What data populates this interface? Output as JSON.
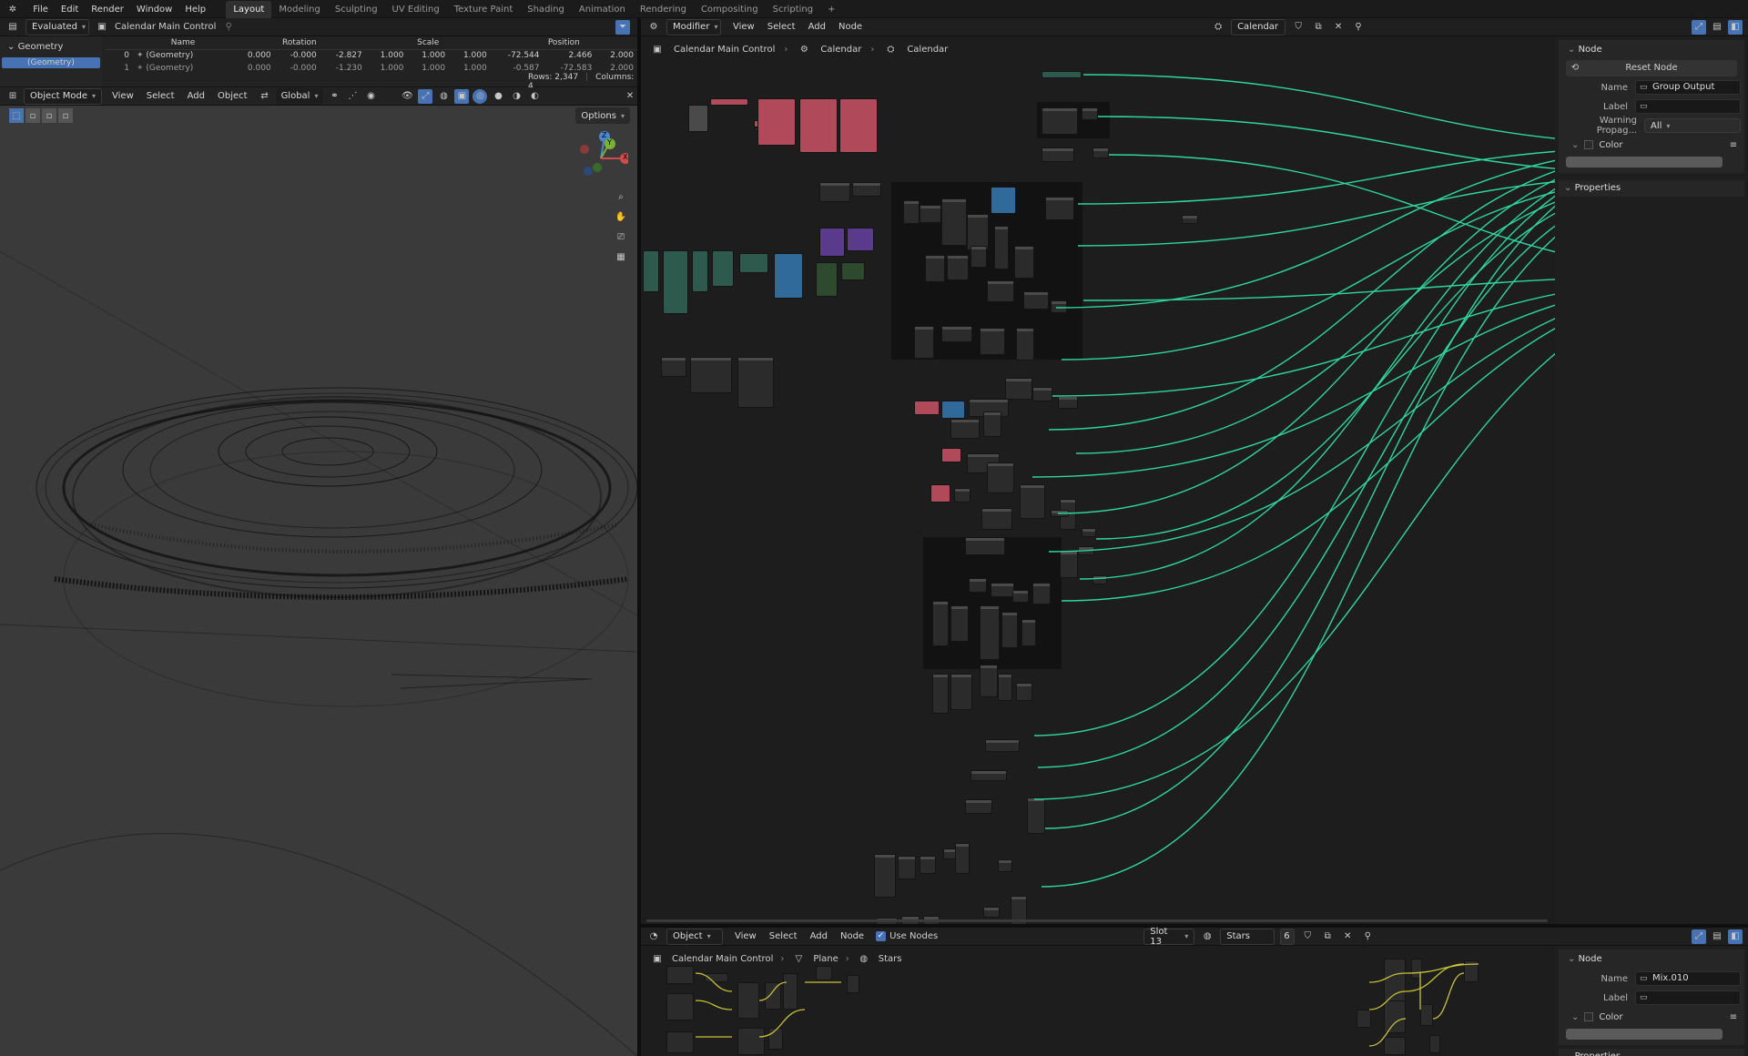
{
  "topbar": {
    "menus": [
      "File",
      "Edit",
      "Render",
      "Window",
      "Help"
    ],
    "workspaces": [
      "Layout",
      "Modeling",
      "Sculpting",
      "UV Editing",
      "Texture Paint",
      "Shading",
      "Animation",
      "Rendering",
      "Compositing",
      "Scripting"
    ],
    "active_workspace": "Layout",
    "add_tab": "+"
  },
  "spreadsheet": {
    "mode": "Evaluated",
    "object": "Calendar Main Control",
    "sidebar_item": "Geometry",
    "sidebar_subitem": "(Geometry)",
    "columns": [
      "Name",
      "Rotation",
      "Scale",
      "Position"
    ],
    "rows": [
      {
        "index": "0",
        "name": "(Geometry)",
        "rot": [
          "0.000",
          "-0.000",
          "-2.827"
        ],
        "scale": [
          "1.000",
          "1.000",
          "1.000"
        ],
        "pos": [
          "-72.544",
          "2.466",
          "2.000"
        ]
      },
      {
        "index": "1",
        "name": "(Geometry)",
        "rot": [
          "0.000",
          "-0.000",
          "-1.230"
        ],
        "scale": [
          "1.000",
          "1.000",
          "1.000"
        ],
        "pos": [
          "-0.587",
          "-72.583",
          "2.000"
        ]
      }
    ],
    "rows_label": "Rows: 2,347",
    "columns_label": "Columns: 4"
  },
  "viewport": {
    "mode": "Object Mode",
    "menus": [
      "View",
      "Select",
      "Add",
      "Object"
    ],
    "transform": "Global",
    "options": "Options",
    "gizmo": {
      "x": "X",
      "y": "Y",
      "z": "Z"
    }
  },
  "node_editor": {
    "type": "Modifier",
    "menus": [
      "View",
      "Select",
      "Add",
      "Node"
    ],
    "tree_name": "Calendar",
    "breadcrumb": [
      "Calendar Main Control",
      "Calendar",
      "Calendar"
    ]
  },
  "node_sidebar": {
    "section": "Node",
    "reset_button": "Reset Node",
    "name_label": "Name",
    "name_value": "Group Output",
    "label_label": "Label",
    "label_value": "",
    "warning_label": "Warning Propag...",
    "warning_value": "All",
    "color_label": "Color",
    "properties_label": "Properties"
  },
  "shader_editor": {
    "type": "Object",
    "menus": [
      "View",
      "Select",
      "Add",
      "Node"
    ],
    "use_nodes": "Use Nodes",
    "slot": "Slot 13",
    "material": "Stars",
    "users": "6",
    "breadcrumb": [
      "Calendar Main Control",
      "Plane",
      "Stars"
    ]
  },
  "shader_sidebar": {
    "section": "Node",
    "name_label": "Name",
    "name_value": "Mix.010",
    "label_label": "Label",
    "label_value": "",
    "color_label": "Color",
    "properties_label": "Properties"
  },
  "colors": {
    "link_green": "#2fd6a0",
    "link_yellow": "#c8c23a",
    "accent": "#4772b3",
    "node_red": "#b04a5a",
    "node_purple": "#5a3a8a",
    "node_teal": "#2e5a4e"
  }
}
